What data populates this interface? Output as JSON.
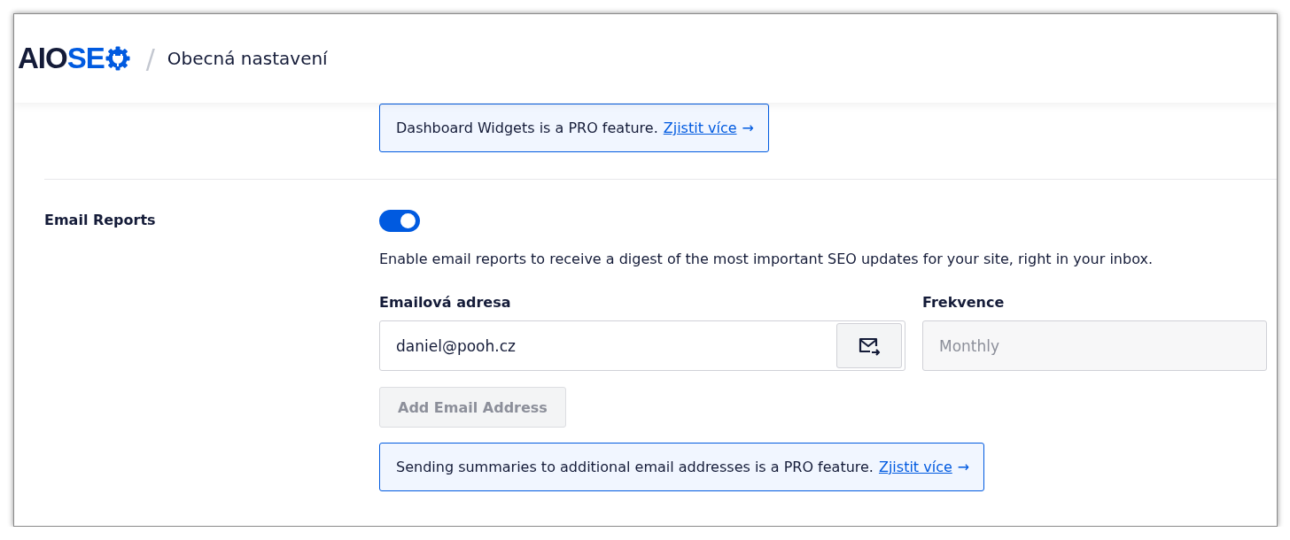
{
  "header": {
    "logo": {
      "dark": "AIO",
      "accent": "SE"
    },
    "separator": "/",
    "title": "Obecná nastavení"
  },
  "dashboard_notice": {
    "text": "Dashboard Widgets is a PRO feature.",
    "link": "Zjistit více",
    "arrow": "→"
  },
  "email_reports": {
    "label": "Email Reports",
    "on": true,
    "description": "Enable email reports to receive a digest of the most important SEO updates for your site, right in your inbox.",
    "email": {
      "label": "Emailová adresa",
      "value": "daniel@pooh.cz"
    },
    "frequency": {
      "label": "Frekvence",
      "value": "Monthly",
      "disabled": true
    },
    "add_button": {
      "label": "Add Email Address",
      "disabled": true
    },
    "notice": {
      "text": "Sending summaries to additional email addresses is a PRO feature.",
      "link": "Zjistit více",
      "arrow": "→"
    }
  }
}
